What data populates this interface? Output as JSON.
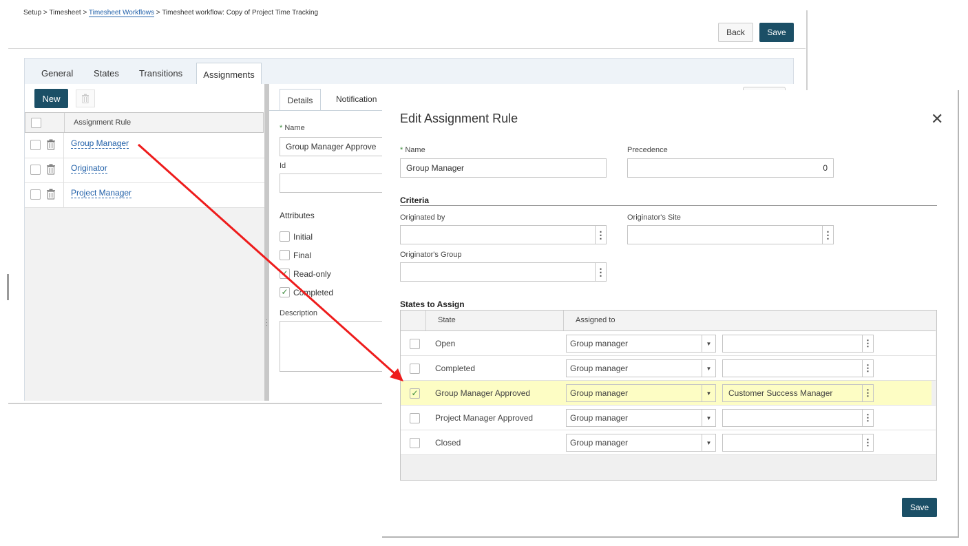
{
  "breadcrumb": {
    "setup": "Setup >",
    "timesheet": "Timesheet >",
    "workflows_link": "Timesheet Workflows",
    "sep": ">",
    "current": "Timesheet workflow: Copy of Project Time Tracking"
  },
  "header": {
    "back_label": "Back",
    "save_label": "Save"
  },
  "tabs": [
    {
      "label": "General"
    },
    {
      "label": "States"
    },
    {
      "label": "Transitions"
    },
    {
      "label": "Assignments",
      "active": true
    }
  ],
  "left_pane": {
    "new_label": "New",
    "column_header": "Assignment Rule",
    "rows": [
      {
        "name": "Group Manager"
      },
      {
        "name": "Originator"
      },
      {
        "name": "Project Manager"
      }
    ]
  },
  "detail": {
    "tabs": [
      {
        "label": "Details"
      },
      {
        "label": "Notification"
      }
    ],
    "name_label": "Name",
    "name_value": "Group Manager Approve",
    "id_label": "Id",
    "attributes_label": "Attributes",
    "attributes": [
      {
        "label": "Initial",
        "checked": false
      },
      {
        "label": "Final",
        "checked": false
      },
      {
        "label": "Read-only",
        "checked": true
      },
      {
        "label": "Completed",
        "checked": true
      }
    ],
    "description_label": "Description"
  },
  "modal": {
    "title": "Edit Assignment Rule",
    "name_label": "Name",
    "name_value": "Group Manager",
    "precedence_label": "Precedence",
    "precedence_value": "0",
    "criteria_title": "Criteria",
    "originated_by_label": "Originated by",
    "originators_site_label": "Originator's Site",
    "originators_group_label": "Originator's Group",
    "states_title": "States to Assign",
    "col_state": "State",
    "col_assigned": "Assigned to",
    "states": [
      {
        "state": "Open",
        "assigned": "Group manager",
        "value": "",
        "checked": false
      },
      {
        "state": "Completed",
        "assigned": "Group manager",
        "value": "",
        "checked": false
      },
      {
        "state": "Group Manager Approved",
        "assigned": "Group manager",
        "value": "Customer Success Manager",
        "checked": true
      },
      {
        "state": "Project Manager Approved",
        "assigned": "Group manager",
        "value": "",
        "checked": false
      },
      {
        "state": "Closed",
        "assigned": "Group manager",
        "value": "",
        "checked": false
      }
    ],
    "save_label": "Save"
  },
  "colors": {
    "primary": "#1b4f66",
    "link": "#1f5fa8",
    "highlight": "#fdfdc4",
    "arrow": "#ee1c1c"
  }
}
